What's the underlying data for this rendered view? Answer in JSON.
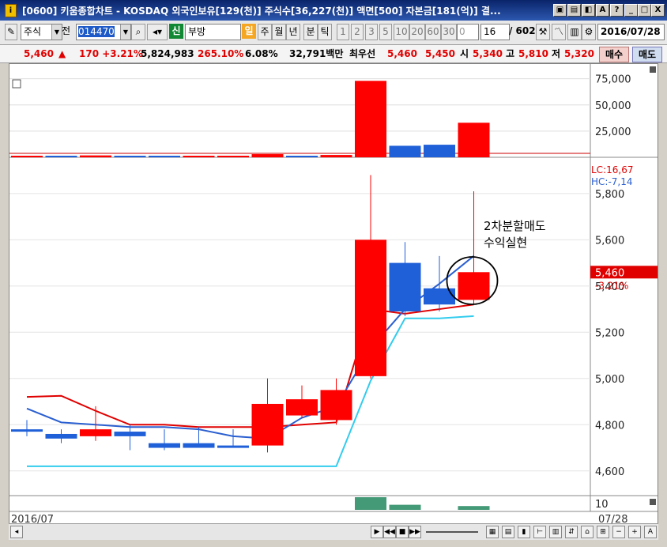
{
  "window": {
    "title": "[0600] 키움종합차트 - KOSDAQ 외국인보유[129(천)] 주식수[36,227(천)] 액면[500] 자본금[181(억)] 결...",
    "buttons": [
      "_",
      "□",
      "X"
    ]
  },
  "toolbar": {
    "market": "주식",
    "prev_label": "전",
    "code": "014470",
    "stock_name": "부방",
    "shin": "신",
    "periods": [
      "일",
      "주",
      "월",
      "년",
      "분",
      "틱"
    ],
    "active_period": "일",
    "numbers": [
      "1",
      "2",
      "3",
      "5",
      "10",
      "20",
      "60",
      "30",
      "0"
    ],
    "count": "16",
    "total": "/ 602",
    "date": "2016/07/28"
  },
  "quote": {
    "price": "5,460",
    "arrow": "▲",
    "change": "170 +3.21%",
    "volume": "5,824,983",
    "volume_ratio": "265.10%",
    "turnover": "6.08%",
    "amount": "32,791백만",
    "best_label": "최우선",
    "ask": "5,460",
    "bid": "5,450",
    "open_label": "시",
    "open": "5,340",
    "high_label": "고",
    "high": "5,810",
    "low_label": "저",
    "low": "5,320",
    "buy_label": "매수",
    "sell_label": "매도"
  },
  "chart_data": {
    "type": "candlestick",
    "period_label": "2016/07",
    "end_label": "07/28",
    "price_axis": [
      5800,
      5600,
      5400,
      5200,
      5000,
      4800,
      4600
    ],
    "price_axis_labels": [
      "5,800",
      "5,600",
      "5,400",
      "5,200",
      "5,000",
      "4,800",
      "4,600"
    ],
    "ylim": [
      4500,
      5950
    ],
    "last_price_label": "5,460",
    "last_change_label": "-3.21%",
    "lc_label": "LC:16,67",
    "hc_label": "HC:-7,14",
    "candles": [
      {
        "o": 4780,
        "h": 4820,
        "l": 4750,
        "c": 4770
      },
      {
        "o": 4760,
        "h": 4780,
        "l": 4720,
        "c": 4740
      },
      {
        "o": 4750,
        "h": 4880,
        "l": 4730,
        "c": 4780
      },
      {
        "o": 4770,
        "h": 4800,
        "l": 4690,
        "c": 4750
      },
      {
        "o": 4720,
        "h": 4780,
        "l": 4690,
        "c": 4700
      },
      {
        "o": 4720,
        "h": 4790,
        "l": 4700,
        "c": 4700
      },
      {
        "o": 4710,
        "h": 4780,
        "l": 4700,
        "c": 4700
      },
      {
        "o": 4710,
        "h": 5000,
        "l": 4680,
        "c": 4890
      },
      {
        "o": 4840,
        "h": 4970,
        "l": 4830,
        "c": 4910
      },
      {
        "o": 4820,
        "h": 5000,
        "l": 4800,
        "c": 4950
      },
      {
        "o": 5010,
        "h": 5880,
        "l": 5000,
        "c": 5600
      },
      {
        "o": 5500,
        "h": 5590,
        "l": 5270,
        "c": 5290
      },
      {
        "o": 5390,
        "h": 5530,
        "l": 5290,
        "c": 5320
      },
      {
        "o": 5340,
        "h": 5810,
        "l": 5320,
        "c": 5460
      }
    ],
    "ma_red": [
      4920,
      4925,
      4860,
      4800,
      4800,
      4790,
      4790,
      4790,
      4800,
      4810,
      5300,
      5280,
      5300,
      5320
    ],
    "ma_blue": [
      4870,
      4810,
      4800,
      4790,
      4790,
      4780,
      4750,
      4740,
      4830,
      4880,
      5130,
      5300,
      5410,
      5530
    ],
    "ma_cyan": [
      4620,
      4620,
      4620,
      4620,
      4620,
      4620,
      4620,
      4620,
      4620,
      4620,
      4990,
      5260,
      5260,
      5270
    ],
    "volume_axis_labels": [
      "75,000",
      "50,000",
      "25,000"
    ],
    "volumes": [
      1500,
      1500,
      1800,
      1200,
      1200,
      1300,
      900,
      3000,
      1500,
      2200,
      73000,
      11000,
      12000,
      33000
    ],
    "volume_colors": [
      "red",
      "blue",
      "red",
      "blue",
      "blue",
      "red",
      "red",
      "red",
      "blue",
      "red",
      "red",
      "blue",
      "blue",
      "red"
    ],
    "sub_values": [
      0,
      0,
      0,
      0,
      0,
      0,
      0,
      0,
      0,
      0,
      10,
      4,
      0,
      3
    ],
    "sub_axis_label": "10",
    "annotation_line1": "2차분할매도",
    "annotation_line2": "수익실현"
  },
  "colors": {
    "up": "#ff0000",
    "down": "#1f5fd8",
    "ma_red": "#e00000",
    "ma_blue": "#2a5fd0",
    "ma_cyan": "#33ccee"
  }
}
